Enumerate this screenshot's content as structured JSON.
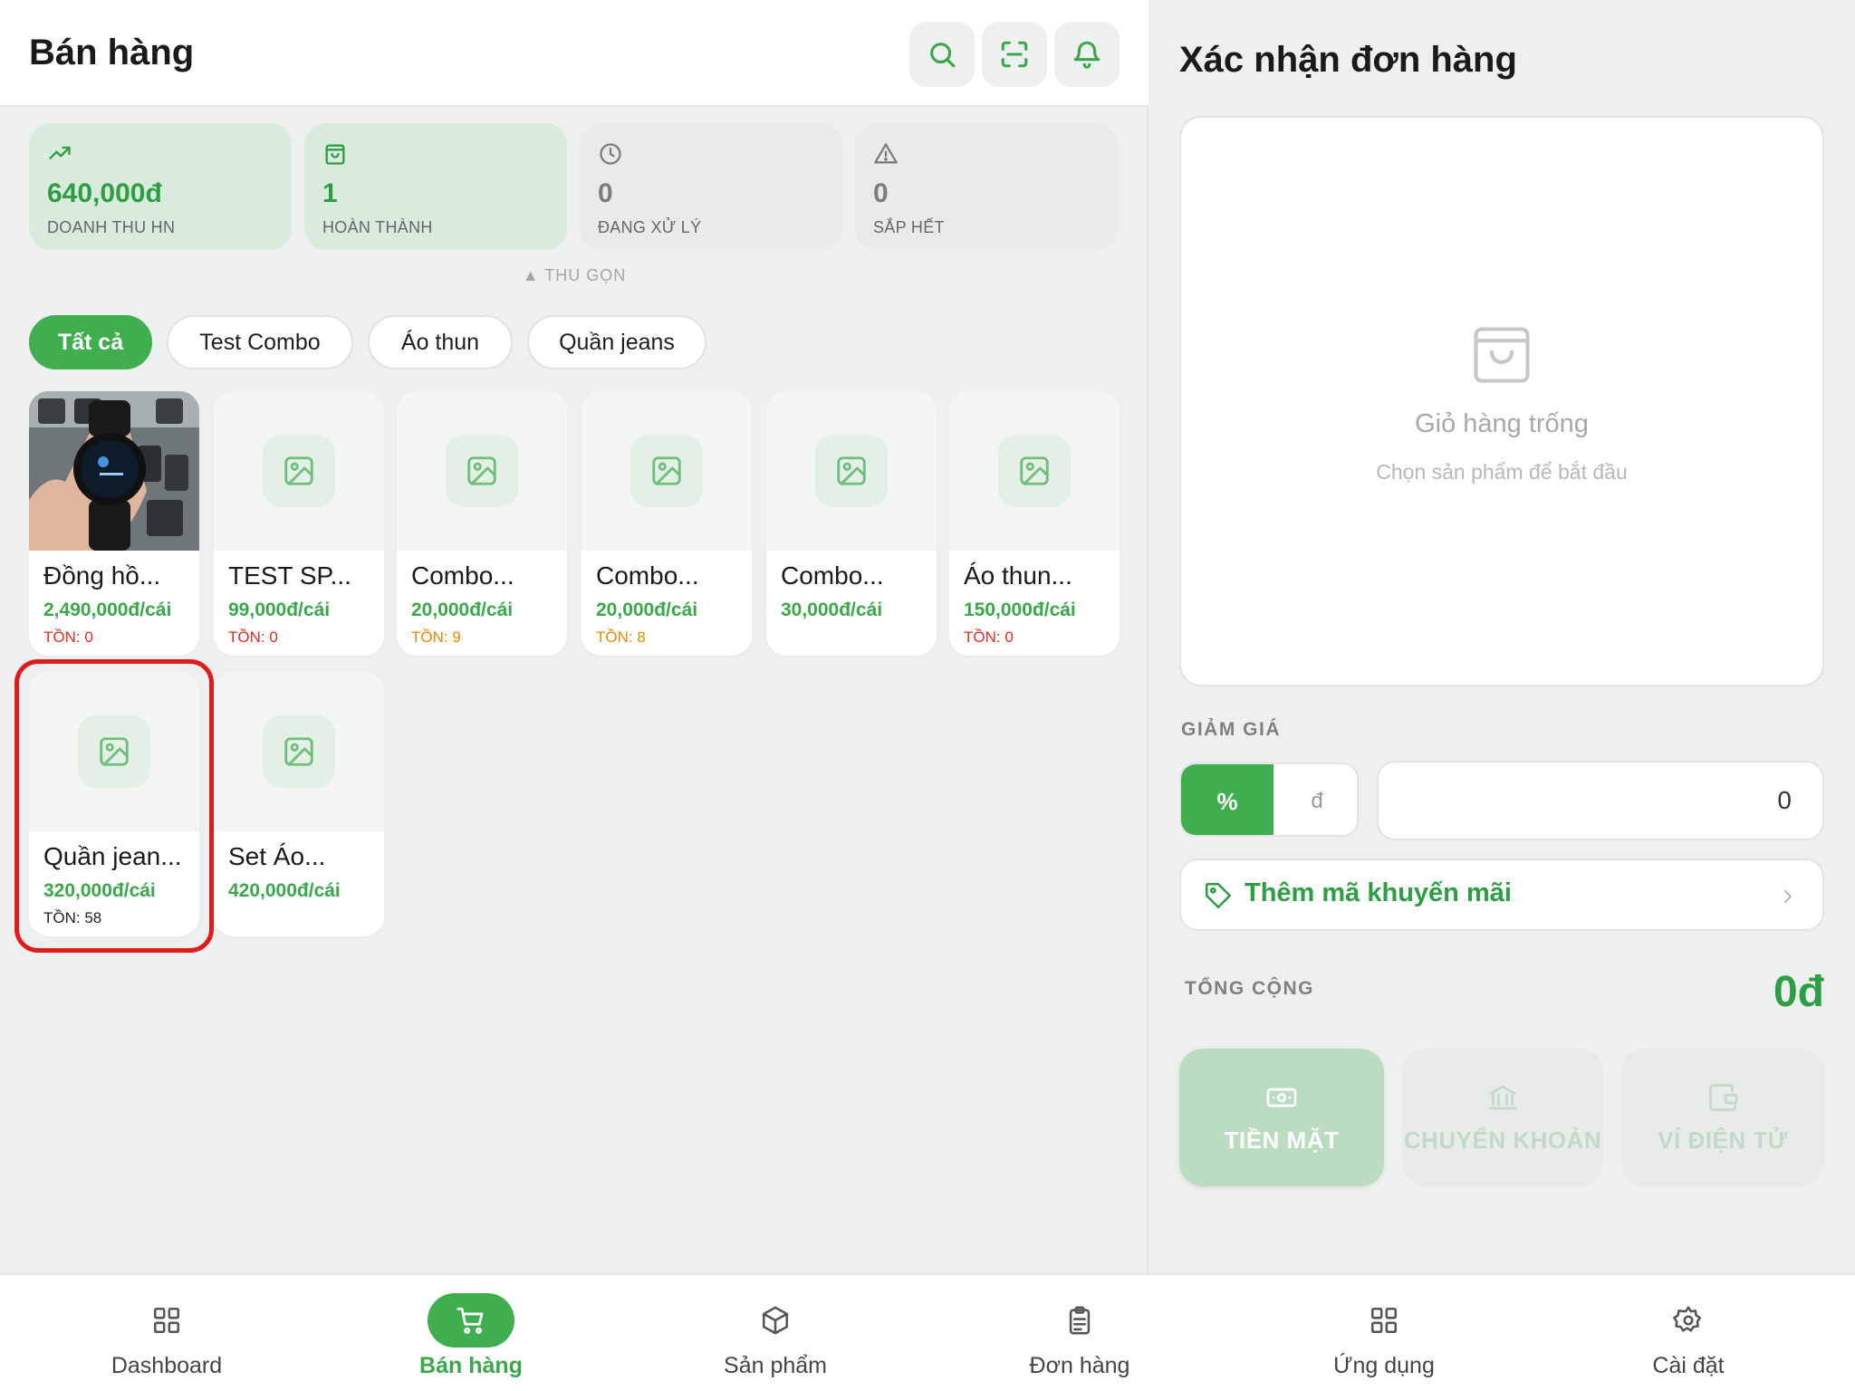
{
  "header": {
    "title": "Bán hàng"
  },
  "stats": [
    {
      "value": "640,000đ",
      "label": "DOANH THU HN",
      "icon": "trend-up-icon"
    },
    {
      "value": "1",
      "label": "HOÀN THÀNH",
      "icon": "bag-icon"
    },
    {
      "value": "0",
      "label": "ĐANG XỬ LÝ",
      "icon": "clock-icon"
    },
    {
      "value": "0",
      "label": "SẮP HẾT",
      "icon": "warning-icon"
    }
  ],
  "collapse_label": "▲ THU GỌN",
  "categories": [
    "Tất cả",
    "Test Combo",
    "Áo thun",
    "Quần jeans"
  ],
  "products": [
    {
      "name": "Đồng hồ...",
      "price": "2,490,000đ/cái",
      "stock": "TỒN: 0"
    },
    {
      "name": "TEST SP...",
      "price": "99,000đ/cái",
      "stock": "TỒN: 0"
    },
    {
      "name": "Combo...",
      "price": "20,000đ/cái",
      "stock": "TỒN: 9"
    },
    {
      "name": "Combo...",
      "price": "20,000đ/cái",
      "stock": "TỒN: 8"
    },
    {
      "name": "Combo...",
      "price": "30,000đ/cái",
      "stock": ""
    },
    {
      "name": "Áo thun...",
      "price": "150,000đ/cái",
      "stock": "TỒN: 0"
    },
    {
      "name": "Quần jean...",
      "price": "320,000đ/cái",
      "stock": "TỒN: 58"
    },
    {
      "name": "Set Áo...",
      "price": "420,000đ/cái",
      "stock": ""
    }
  ],
  "order": {
    "title": "Xác nhận đơn hàng",
    "empty_title": "Giỏ hàng trống",
    "empty_sub": "Chọn sản phẩm để bắt đầu",
    "discount_label": "GIẢM GIÁ",
    "discount_pct": "%",
    "discount_vnd": "đ",
    "discount_value": "0",
    "promo_label": "Thêm mã khuyến mãi",
    "total_label": "TỔNG CỘNG",
    "total_value": "0đ",
    "payments": [
      "TIỀN MẶT",
      "CHUYỂN KHOẢN",
      "VÍ ĐIỆN TỬ"
    ]
  },
  "nav": [
    "Dashboard",
    "Bán hàng",
    "Sản phẩm",
    "Đơn hàng",
    "Ứng dụng",
    "Cài đặt"
  ],
  "colors": {
    "accent": "#3fae4f",
    "price": "#3aa84a",
    "stock_out": "#d93025",
    "stock_low": "#e68a00",
    "highlight": "#e01b1b"
  }
}
